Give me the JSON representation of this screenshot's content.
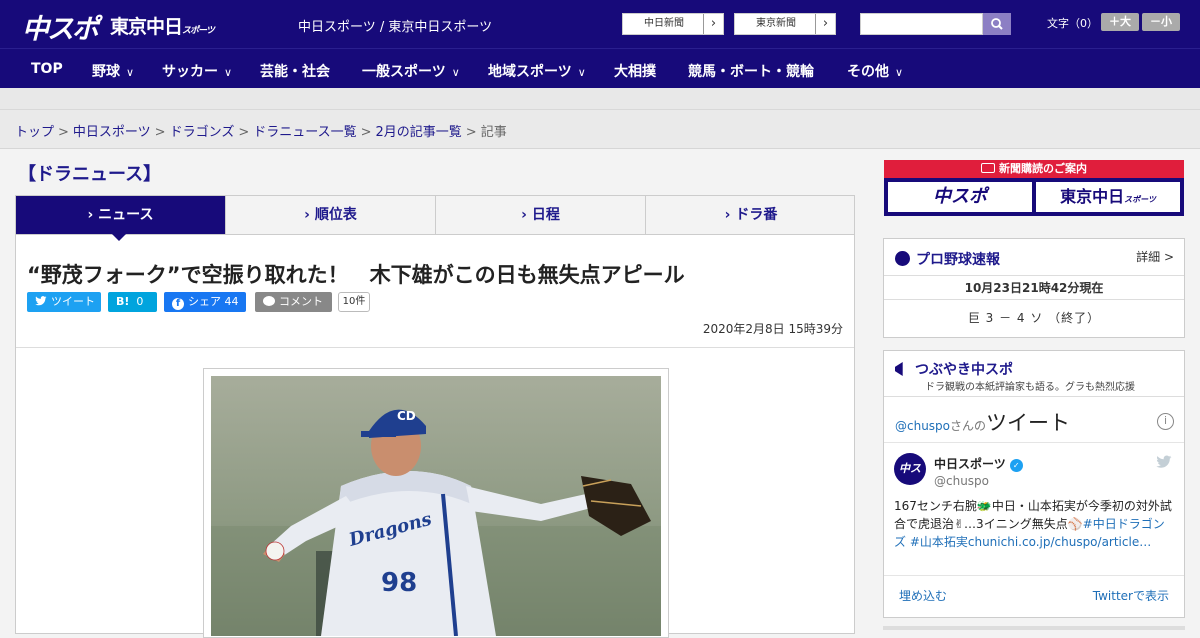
{
  "header": {
    "logo_main": "中スポ",
    "logo_tokyo": "東京中日",
    "logo_tokyo_sub": "スポーツ",
    "site_name": "中日スポーツ / 東京中日スポーツ",
    "paper_links": [
      "中日新聞",
      "東京新聞"
    ],
    "font_size_label": "文字（0）",
    "font_bigger": "＋大",
    "font_smaller": "－小"
  },
  "nav": {
    "items": [
      {
        "label": "TOP",
        "has_dropdown": false
      },
      {
        "label": "野球",
        "has_dropdown": true
      },
      {
        "label": "サッカー",
        "has_dropdown": true
      },
      {
        "label": "芸能・社会",
        "has_dropdown": false
      },
      {
        "label": "一般スポーツ",
        "has_dropdown": true
      },
      {
        "label": "地域スポーツ",
        "has_dropdown": true
      },
      {
        "label": "大相撲",
        "has_dropdown": false
      },
      {
        "label": "競馬・ボート・競輪",
        "has_dropdown": false
      },
      {
        "label": "その他",
        "has_dropdown": true
      }
    ],
    "dropdown_glyph": "∨"
  },
  "breadcrumb": {
    "items": [
      "トップ",
      "中日スポーツ",
      "ドラゴンズ",
      "ドラニュース一覧",
      "2月の記事一覧"
    ],
    "current": "記事",
    "separator": ">"
  },
  "section_title": "【ドラニュース】",
  "tabs": [
    {
      "label": "ニュース",
      "active": true
    },
    {
      "label": "順位表",
      "active": false
    },
    {
      "label": "日程",
      "active": false
    },
    {
      "label": "ドラ番",
      "active": false
    }
  ],
  "article": {
    "headline": "“野茂フォーク”で空振り取れた！　木下雄がこの日も無失点アピール",
    "share": {
      "tweet": "ツイート",
      "hatena": "B!",
      "hatena_count": "0",
      "facebook": "シェア",
      "facebook_count": "44",
      "comment": "コメント",
      "comment_count": "10件"
    },
    "date": "2020年2月8日 15時39分",
    "photo": {
      "cap_logo": "CD",
      "jersey_text": "Dragons",
      "jersey_number": "98"
    }
  },
  "sidebar": {
    "subscribe": {
      "band": "新聞購読のご案内",
      "logos": [
        "中スポ",
        "東京中日"
      ],
      "logo_sub": "スポーツ"
    },
    "score": {
      "title": "プロ野球速報",
      "detail": "詳細 >",
      "time": "10月23日21時42分現在",
      "line": "巨 3 － 4 ソ （終了）"
    },
    "tweets": {
      "title": "つぶやき中スポ",
      "subtitle": "ドラ観戦の本紙評論家も語る。グラも熱烈応援",
      "handle_prefix": "@chuspo",
      "handle_suffix": "さんの",
      "heading": "ツイート",
      "info": "i",
      "account_name": "中日スポーツ",
      "account_handle": "@chuspo",
      "avatar_text": "中スポ",
      "tweet_text": "167センチ右腕🐲中日・山本拓実が今季初の対外試合で虎退治✌…3イニング無失点⚾",
      "tweet_links": "#中日ドラゴンズ #山本拓実chunichi.co.jp/chuspo/article…",
      "embed": "埋め込む",
      "view": "Twitterで表示"
    }
  },
  "colors": {
    "brand_navy": "#170a7a",
    "link": "#1f1a8c",
    "twitter": "#1da1f2",
    "hatena": "#00a4de",
    "facebook": "#1877f2",
    "subscribe_red": "#e01e3c"
  }
}
